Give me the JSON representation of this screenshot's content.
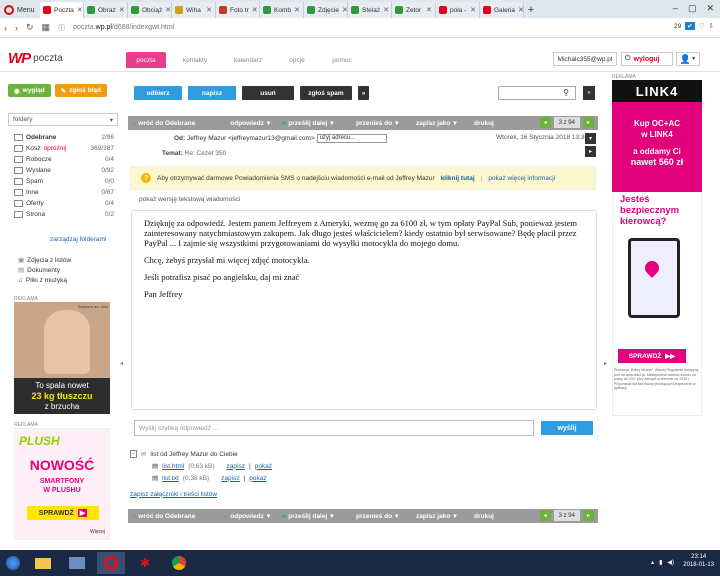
{
  "browser": {
    "menu_label": "Menu",
    "tabs": [
      {
        "label": "Poczta",
        "color": "#e3001b"
      },
      {
        "label": "Obraz",
        "color": "#2a9d3a"
      },
      {
        "label": "Obciąż",
        "color": "#2a9d3a"
      },
      {
        "label": "Wiha",
        "color": "#d4a017"
      },
      {
        "label": "Foto tr",
        "color": "#c0392b"
      },
      {
        "label": "Komb",
        "color": "#2a9d3a"
      },
      {
        "label": "Zdjęcie",
        "color": "#2a9d3a"
      },
      {
        "label": "Stelaż",
        "color": "#2a9d3a"
      },
      {
        "label": "Zetor",
        "color": "#2a9d3a"
      },
      {
        "label": "pola -",
        "color": "#e3001b"
      },
      {
        "label": "Galeria",
        "color": "#e3001b"
      }
    ],
    "new_tab": "+",
    "url_prefix": "poczta.",
    "url_domain": "wp.pl",
    "url_path": "/d688/indexgwt.html",
    "badge_count": "29"
  },
  "header": {
    "logo_wp": "WP",
    "logo_text": "poczta",
    "nav": [
      "poczta",
      "kontakty",
      "kalendarz",
      "opcje",
      "pomoc"
    ],
    "user_email": "Michalc355@wp.pl",
    "logout": "wyloguj"
  },
  "sidebar": {
    "view_btn": "wygląd",
    "bug_btn": "zgłoś błąd",
    "folders_label": "foldery",
    "folders": [
      {
        "name": "Odebrane",
        "count": "2/96",
        "bold": true
      },
      {
        "name": "Kosz",
        "extra": "opróżnij",
        "count": "369/387"
      },
      {
        "name": "Robocze",
        "count": "0/4"
      },
      {
        "name": "Wysłane",
        "count": "0/92"
      },
      {
        "name": "Spam",
        "count": "0/0"
      },
      {
        "name": "Inne",
        "count": "0/67"
      },
      {
        "name": "Oferty",
        "count": "0/4"
      },
      {
        "name": "Strona",
        "count": "0/2"
      }
    ],
    "manage": "zarządzaj folderami",
    "files": [
      "Zdjęcia z listów",
      "Dokumenty",
      "Pliki z muzyką"
    ],
    "ad_label": "REKLAMA",
    "ad1_line1": "To spala nowet",
    "ad1_line2": "23 kg tłuszczu",
    "ad1_line3": "z brzucha",
    "ad1_tag": "Sephora art. disc",
    "ad2_brand": "PLUSH",
    "ad2_now": "NOWOŚĆ",
    "ad2_line1": "SMARTFONY",
    "ad2_line2": "W PLUSHU",
    "ad2_cta": "SPRAWDŹ",
    "ad2_more": "Więcej"
  },
  "toolbar": {
    "receive": "odbierz",
    "write": "napisz",
    "delete": "usuń",
    "spam": "zgłoś spam",
    "more": "»"
  },
  "actionbar": {
    "back": "wróć do Odebrane",
    "reply": "odpowiedz",
    "forward": "prześlij dalej",
    "move": "przenieś do",
    "save": "zapisz jako",
    "print": "drukuj",
    "pager": "3 z 94"
  },
  "message": {
    "from_label": "Od:",
    "from_value": "Jeffrey Mazur <jeffreymazur13@gmail.com>",
    "from_select": "użyj adresu...",
    "date": "Wtorek, 16 Stycznia 2018 13:30",
    "subject_label": "Temat:",
    "subject_value": "Re: Cezet 350",
    "sms_text": "Aby otrzymywać darmowe Powiadomienia SMS o nadejściu wiadomości e-mail od Jeffrey Mazur",
    "sms_link": "kliknij tutaj",
    "sms_more": "pokaż więcej informacji",
    "text_version": "pokaż wersję tekstową wiadomości",
    "body": [
      "Dziękuję za odpowiedź. Jestem panem Jeffreyem z Ameryki, wezmę go za 6100 zł, w tym opłaty PayPal Sub, ponieważ jestem zainteresowany natychmiastowym zakupem. Jak długo jesteś właścicielem? kiedy ostatnio był serwisowane? Będę płacił przez PayPal ... I zajmie się wszystkimi przygotowaniami do wysyłki motocykla do mojego domu.",
      "Chcę, żebyś przysłał mi więcej zdjęć motocykla.",
      "Jeśli potrafisz pisać po angielsku, daj mi znać",
      "Pan Jeffrey"
    ],
    "quick_reply_placeholder": "Wyślij szybką odpowiedź ...",
    "send": "wyślij",
    "thread": "list od Jeffrey Mazur do Ciebie",
    "attachments": [
      {
        "name": "list.html",
        "size": "(0,63 kB)"
      },
      {
        "name": "list.txt",
        "size": "(0,38 kB)"
      }
    ],
    "save_link": "zapisz",
    "show_link": "pokaż",
    "save_all": "zapisz załączniki i treści listów"
  },
  "right_ad": {
    "label": "REKLAMA",
    "brand": "LINK4",
    "l1": "Kup OC+AC",
    "l2": "w LINK4",
    "l3": "a oddamy Ci",
    "l4": "nawet 560 zł",
    "s1": "Jesteś",
    "s2": "bezpiecznym",
    "s3": "kierowcą?",
    "cta": "SPRAWDŹ",
    "fine": "Promocja „Dobry Wózek”. Więcej Regulamin dostępny pod na www.link4.pl. Maksymalna wartość zwrotu od polisy AC+OC przy zakupie w terminie od 2018 r. Przyznania dla kierowców jezdzących bezpiecznie w aplikacji."
  },
  "taskbar": {
    "time": "23:14",
    "date": "2018-01-13"
  }
}
